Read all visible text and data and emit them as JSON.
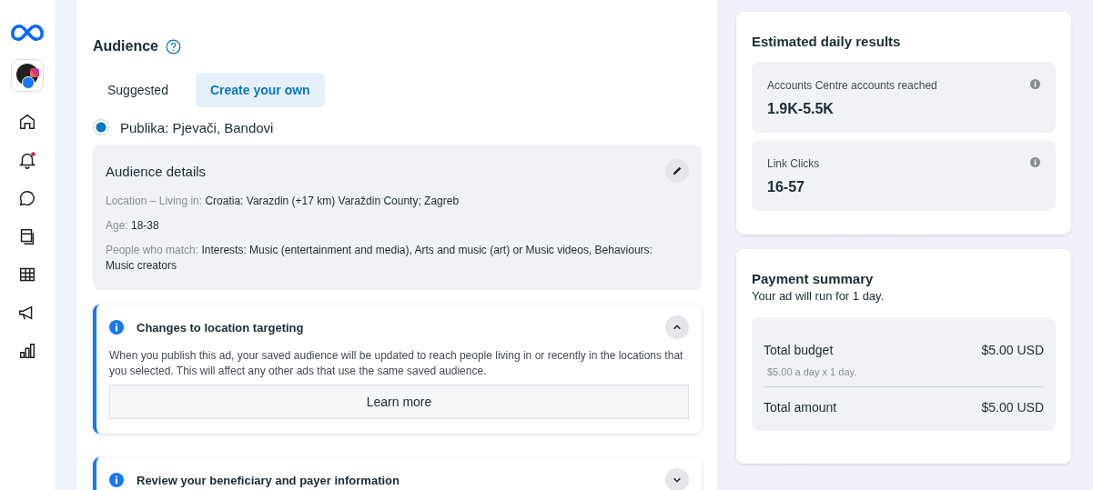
{
  "sidebar": {
    "items": [
      {
        "kind": "home",
        "unread": false
      },
      {
        "kind": "notifications",
        "unread": true
      },
      {
        "kind": "messages",
        "unread": false
      },
      {
        "kind": "pages",
        "unread": false
      },
      {
        "kind": "table",
        "unread": false
      },
      {
        "kind": "ads",
        "unread": false
      },
      {
        "kind": "insights",
        "unread": false
      }
    ]
  },
  "audience": {
    "title": "Audience",
    "tabs": [
      {
        "label": "Suggested",
        "selected": false
      },
      {
        "label": "Create your own",
        "selected": true
      }
    ],
    "option": {
      "label": "Publika: Pjevači, Bandovi",
      "selected": true
    },
    "details": {
      "title": "Audience details",
      "lines": [
        {
          "label": "Location – Living in:",
          "value": "Croatia: Varazdin (+17 km) Varaždin County; Zagreb"
        },
        {
          "label": "Age:",
          "value": "18-38"
        },
        {
          "label": "People who match:",
          "value": "Interests: Music (entertainment and media), Arts and music (art) or Music videos, Behaviours: Music creators"
        }
      ]
    },
    "notices": [
      {
        "title": "Changes to location targeting",
        "expanded": true,
        "body": "When you publish this ad, your saved audience will be updated to reach people living in or recently in the locations that you selected. This will affect any other ads that use the same saved audience.",
        "button": "Learn more"
      },
      {
        "title": "Review your beneficiary and payer information",
        "expanded": false
      }
    ]
  },
  "estimated_results": {
    "title": "Estimated daily results",
    "metrics": [
      {
        "label": "Accounts Centre accounts reached",
        "value": "1.9K-5.5K"
      },
      {
        "label": "Link Clicks",
        "value": "16-57"
      }
    ]
  },
  "payment_summary": {
    "title": "Payment summary",
    "subtitle": "Your ad will run for 1 day.",
    "rows": [
      {
        "label": "Total budget",
        "amount": "$5.00 USD",
        "note": "$5.00 a day x 1 day."
      },
      {
        "label": "Total amount",
        "amount": "$5.00 USD"
      }
    ]
  }
}
